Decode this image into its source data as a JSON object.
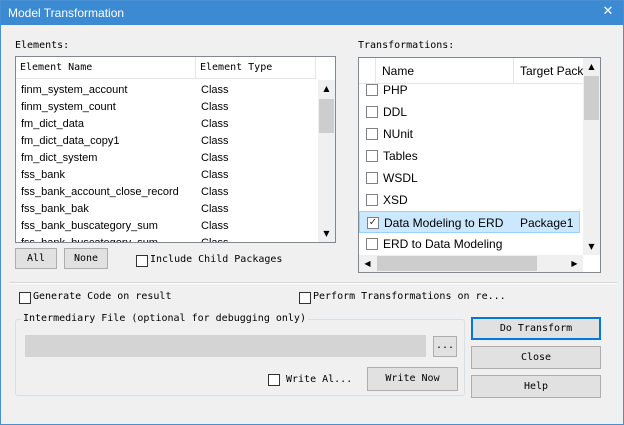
{
  "window": {
    "title": "Model Transformation",
    "close_glyph": "✕"
  },
  "elements": {
    "label": "Elements:",
    "columns": [
      "Element Name",
      "Element Type"
    ],
    "rows": [
      {
        "name": "finm_system_account",
        "type": "Class"
      },
      {
        "name": "finm_system_count",
        "type": "Class"
      },
      {
        "name": "fm_dict_data",
        "type": "Class"
      },
      {
        "name": "fm_dict_data_copy1",
        "type": "Class"
      },
      {
        "name": "fm_dict_system",
        "type": "Class"
      },
      {
        "name": "fss_bank",
        "type": "Class"
      },
      {
        "name": "fss_bank_account_close_record",
        "type": "Class"
      },
      {
        "name": "fss_bank_bak",
        "type": "Class"
      },
      {
        "name": "fss_bank_buscategory_sum",
        "type": "Class"
      },
      {
        "name": "fss_bank_buscategory_sum",
        "type": "Class"
      }
    ],
    "all_button": "All",
    "none_button": "None",
    "include_child_packages": "Include Child Packages"
  },
  "transformations": {
    "label": "Transformations:",
    "columns": [
      "Name",
      "Target Package"
    ],
    "rows": [
      {
        "name": "PHP",
        "target": "",
        "checked": false
      },
      {
        "name": "DDL",
        "target": "",
        "checked": false
      },
      {
        "name": "NUnit",
        "target": "",
        "checked": false
      },
      {
        "name": "Tables",
        "target": "",
        "checked": false
      },
      {
        "name": "WSDL",
        "target": "",
        "checked": false
      },
      {
        "name": "XSD",
        "target": "",
        "checked": false
      },
      {
        "name": "Data Modeling to ERD",
        "target": "Package1",
        "checked": true
      },
      {
        "name": "ERD to Data Modeling",
        "target": "",
        "checked": false
      }
    ]
  },
  "options": {
    "generate_code": "Generate Code on result",
    "perform_transformations": "Perform Transformations on re..."
  },
  "intermediary": {
    "label": "Intermediary File (optional for debugging only)",
    "path_value": "",
    "browse_button": "...",
    "write_always": "Write Al...",
    "write_now_button": "Write Now"
  },
  "actions": {
    "do_transform": "Do Transform",
    "close": "Close",
    "help": "Help"
  },
  "scroll_glyphs": {
    "up": "▲",
    "down": "▼",
    "left": "◀",
    "right": "▶"
  },
  "checkmark": "✓",
  "colors": {
    "titlebar": "#3c8ad2",
    "selected_row": "#cce8ff",
    "default_button_border": "#0078d7"
  }
}
